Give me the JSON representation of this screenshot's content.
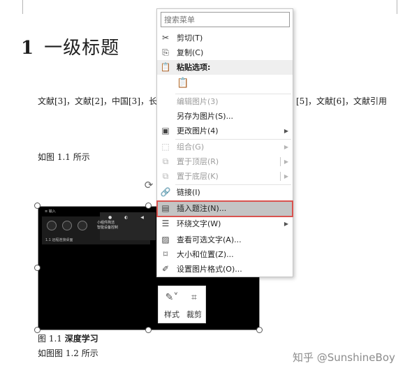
{
  "document": {
    "heading_number": "1",
    "heading_text": "一级标题",
    "paragraph_1_left": "文献[3]，文献[2]，中国[3]，长",
    "paragraph_1_right": "[5]，文献[6]，文献引用",
    "paragraph_2": "如图  1.1 所示",
    "caption_prefix": "图",
    "caption_number": "1.1",
    "caption_text": "深度学习",
    "paragraph_3": "如图图  1.2 所示"
  },
  "picture": {
    "title": "≡ 输入",
    "panel_label": "1.1 远程连接桌面",
    "popup_text": "小组件简洁\n智能设备控制"
  },
  "mini_toolbar": {
    "style_label": "样式",
    "crop_label": "裁剪"
  },
  "context_menu": {
    "search_placeholder": "搜索菜单",
    "items": [
      {
        "label": "剪切(T)",
        "icon": "scissors-icon",
        "disabled": false
      },
      {
        "label": "复制(C)",
        "icon": "copy-icon",
        "disabled": false
      },
      {
        "label": "粘贴选项:",
        "icon": "clipboard-icon",
        "disabled": false
      },
      {
        "label": "编辑图片(3)",
        "icon": "",
        "disabled": true
      },
      {
        "label": "另存为图片(S)...",
        "icon": "",
        "disabled": false
      },
      {
        "label": "更改图片(4)",
        "icon": "change-picture-icon",
        "disabled": false
      },
      {
        "label": "组合(G)",
        "icon": "group-icon",
        "disabled": true
      },
      {
        "label": "置于顶层(R)",
        "icon": "bring-front-icon",
        "disabled": true
      },
      {
        "label": "置于底层(K)",
        "icon": "send-back-icon",
        "disabled": true
      },
      {
        "label": "链接(I)",
        "icon": "link-icon",
        "disabled": false
      },
      {
        "label": "插入题注(N)...",
        "icon": "caption-icon",
        "disabled": false
      },
      {
        "label": "环绕文字(W)",
        "icon": "wrap-text-icon",
        "disabled": false
      },
      {
        "label": "查看可选文字(A)...",
        "icon": "alt-text-icon",
        "disabled": false
      },
      {
        "label": "大小和位置(Z)...",
        "icon": "size-position-icon",
        "disabled": false
      },
      {
        "label": "设置图片格式(O)...",
        "icon": "format-picture-icon",
        "disabled": false
      }
    ]
  },
  "watermark": "知乎 @SunshineBoy",
  "colors": {
    "highlight_border": "#d9534f",
    "highlight_fill": "#c4c4c4",
    "disabled_text": "#9d9d9d"
  }
}
